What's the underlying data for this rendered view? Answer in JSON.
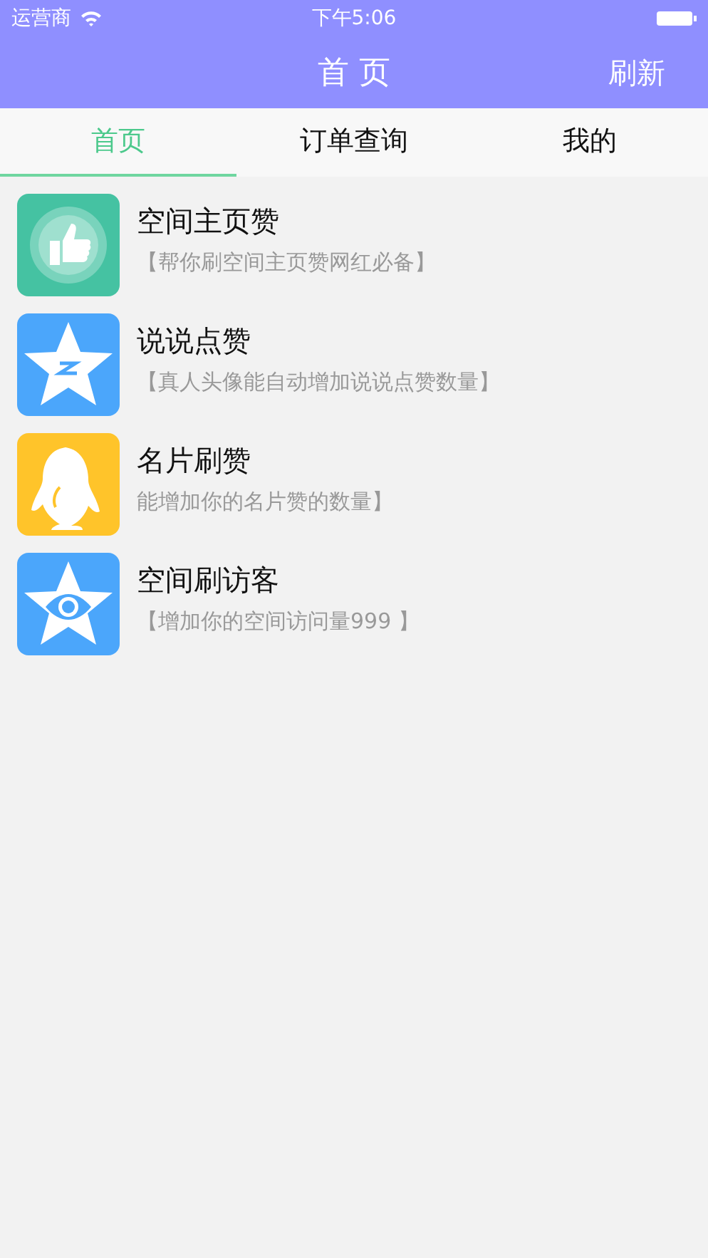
{
  "status_bar": {
    "carrier": "运营商",
    "time": "下午5:06"
  },
  "nav": {
    "title": "首 页",
    "action": "刷新"
  },
  "tabs": [
    {
      "label": "首页",
      "selected": true
    },
    {
      "label": "订单查询",
      "selected": false
    },
    {
      "label": "我的",
      "selected": false
    }
  ],
  "items": [
    {
      "kind": "thumb",
      "title": "空间主页赞",
      "subtitle": "【帮你刷空间主页赞网红必备】"
    },
    {
      "kind": "star-z",
      "title": "说说点赞",
      "subtitle": "【真人头像能自动增加说说点赞数量】"
    },
    {
      "kind": "penguin",
      "title": "名片刷赞",
      "subtitle": "能增加你的名片赞的数量】"
    },
    {
      "kind": "star-eye",
      "title": "空间刷访客",
      "subtitle": "【增加你的空间访问量999 】"
    }
  ]
}
